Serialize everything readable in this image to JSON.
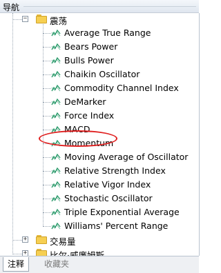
{
  "panel": {
    "title": "导航"
  },
  "tree": {
    "oscillators_folder": "震荡",
    "items": [
      "Average True Range",
      "Bears Power",
      "Bulls Power",
      "Chaikin Oscillator",
      "Commodity Channel Index",
      "DeMarker",
      "Force Index",
      "MACD",
      "Momentum",
      "Moving Average of Oscillator",
      "Relative Strength Index",
      "Relative Vigor Index",
      "Stochastic Oscillator",
      "Triple Exponential Average",
      "Williams' Percent Range"
    ],
    "volumes_folder": "交易量",
    "bill_williams_folder": "比尔·威廉姆斯",
    "expanded_symbol": "−",
    "collapsed_symbol": "+"
  },
  "tabs": {
    "active": "注释",
    "inactive": "收藏夹"
  },
  "colors": {
    "highlight": "#e02020",
    "icon": "#2a9a6a",
    "folder": "#f6cf52"
  },
  "icons": {
    "folder": "folder-icon",
    "indicator": "indicator-icon"
  }
}
